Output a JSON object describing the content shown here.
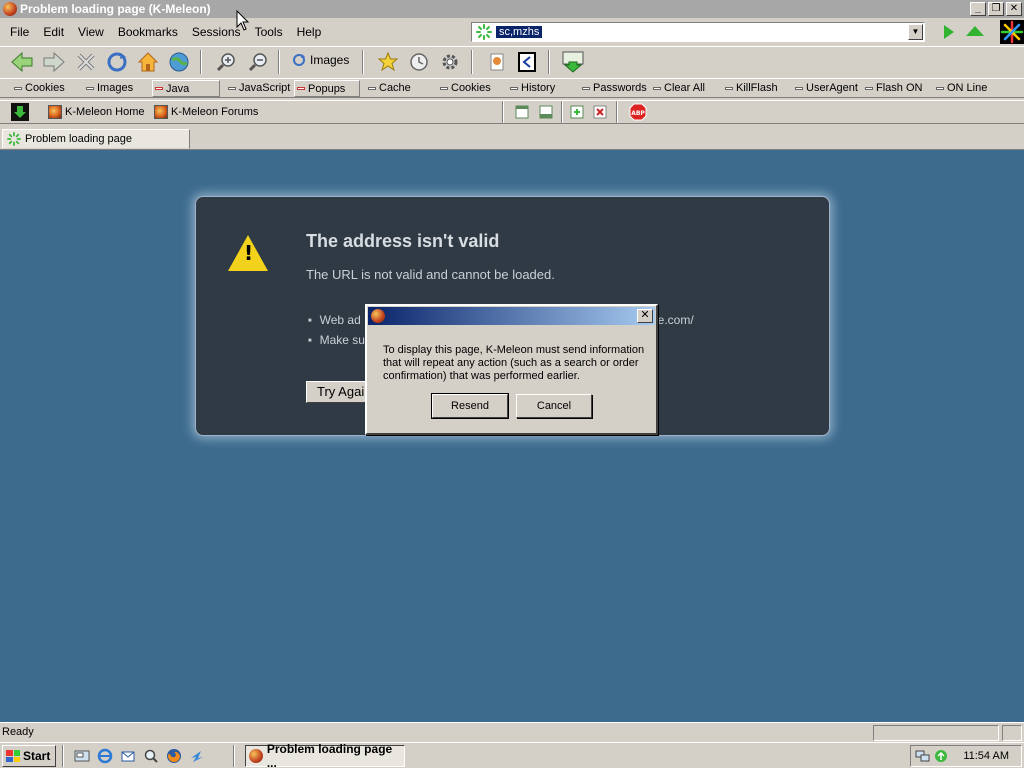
{
  "window": {
    "title": "Problem loading page (K-Meleon)",
    "minimize": "_",
    "maximize": "❐",
    "close": "✕"
  },
  "menu": {
    "items": [
      {
        "label": "File",
        "key": "F"
      },
      {
        "label": "Edit",
        "key": "E"
      },
      {
        "label": "View",
        "key": "V"
      },
      {
        "label": "Bookmarks",
        "key": "B"
      },
      {
        "label": "Sessions",
        "key": "S"
      },
      {
        "label": "Tools",
        "key": "T"
      },
      {
        "label": "Help",
        "key": "H"
      }
    ]
  },
  "urlbar": {
    "value": "sc,mzhs",
    "dropdown": "▼"
  },
  "nav": {
    "images_label": "Images"
  },
  "privacy": {
    "items": [
      "Cookies",
      "Images",
      "Java",
      "JavaScript",
      "Popups",
      "Cache",
      "Cookies",
      "History",
      "Passwords",
      "Clear All",
      "KillFlash",
      "UserAgent",
      "Flash ON",
      "ON Line"
    ]
  },
  "bookmarks": {
    "home": "K-Meleon Home",
    "forums": "K-Meleon Forums"
  },
  "tab": {
    "label": "Problem loading page"
  },
  "error": {
    "title": "The address isn't valid",
    "subtitle": "The URL is not valid and cannot be loaded.",
    "bullets": [
      "Web ad",
      "Make su"
    ],
    "bullet_tail": "le.com/",
    "try_again": "Try Again"
  },
  "dialog": {
    "message": "To display this page, K-Meleon must send information that will repeat any action (such as a search or order confirmation) that was performed earlier.",
    "resend": "Resend",
    "cancel": "Cancel",
    "close": "✕"
  },
  "status": {
    "text": "Ready"
  },
  "taskbar": {
    "start": "Start",
    "task": "Problem loading page ...",
    "clock": "11:54 AM"
  },
  "colors": {
    "content_bg": "#3d6b8e",
    "error_box": "#2f3a44",
    "accent": "#0a246a",
    "warning": "#f2d21a"
  }
}
